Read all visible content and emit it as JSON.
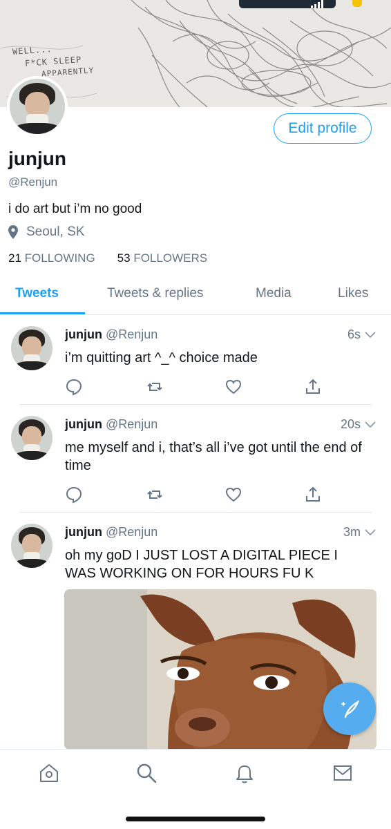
{
  "banner": {
    "text_lines": [
      "WELL...",
      "F*CK SLEEP",
      "APPARENTLY"
    ]
  },
  "profile": {
    "name": "junjun",
    "handle": "@Renjun",
    "bio": "i do art but i’m no good",
    "location": "Seoul, SK",
    "following_count": "21",
    "following_label": "FOLLOWING",
    "followers_count": "53",
    "followers_label": "FOLLOWERS",
    "edit_button": "Edit profile"
  },
  "tabs": [
    {
      "label": "Tweets",
      "active": true
    },
    {
      "label": "Tweets & replies",
      "active": false
    },
    {
      "label": "Media",
      "active": false
    },
    {
      "label": "Likes",
      "active": false
    }
  ],
  "tweets": [
    {
      "name": "junjun",
      "handle": "@Renjun",
      "time": "6s",
      "text": "i’m quitting art ^_^ choice made"
    },
    {
      "name": "junjun",
      "handle": "@Renjun",
      "time": "20s",
      "text": "me myself and i, that’s all i’ve got until the end of time"
    },
    {
      "name": "junjun",
      "handle": "@Renjun",
      "time": "3m",
      "text": "oh my goD I JUST LOST A DIGITAL PIECE I WAS WORKING ON FOR HOURS FU K"
    }
  ],
  "icons": {
    "location": "map-pin-icon",
    "reply": "comment-icon",
    "retweet": "retweet-icon",
    "like": "heart-icon",
    "share": "share-icon",
    "chevron": "chevron-down-icon",
    "compose": "compose-tweet-icon",
    "nav": [
      "home-icon",
      "search-icon",
      "notifications-icon",
      "messages-icon"
    ]
  },
  "colors": {
    "accent": "#1da1f2",
    "secondary_text": "#657786",
    "fab": "#55acee"
  }
}
